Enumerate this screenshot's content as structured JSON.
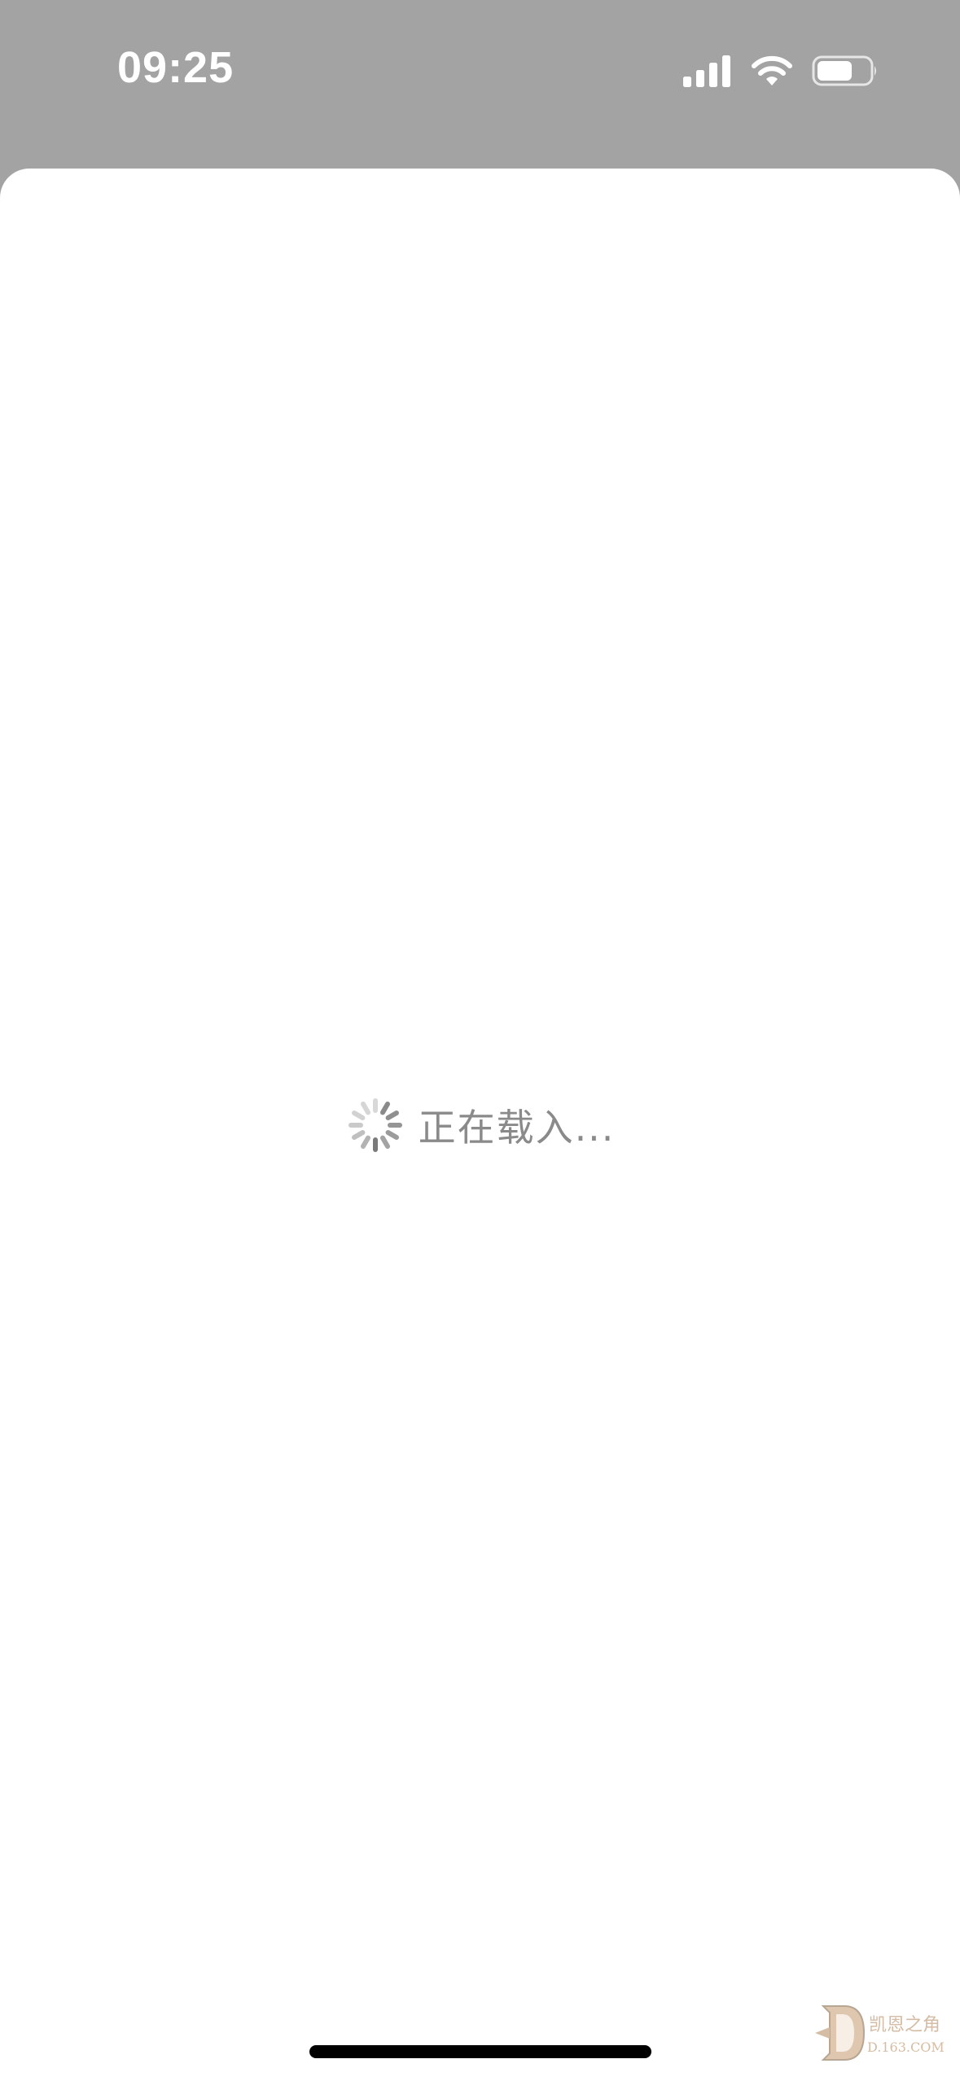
{
  "status_bar": {
    "time": "09:25",
    "icons": [
      "cellular-signal-icon",
      "wifi-icon",
      "battery-icon"
    ],
    "text_color": "#ffffff",
    "background": "#a3a3a3"
  },
  "loading": {
    "text": "正在载入...",
    "icon": "spinner-icon",
    "text_color": "#8a8a8a"
  },
  "watermark": {
    "text_cn": "凯恩之角",
    "text_url": "D.163.COM",
    "icon": "diablo-d-logo"
  },
  "colors": {
    "sheet_background": "#ffffff",
    "home_indicator": "#000000"
  }
}
